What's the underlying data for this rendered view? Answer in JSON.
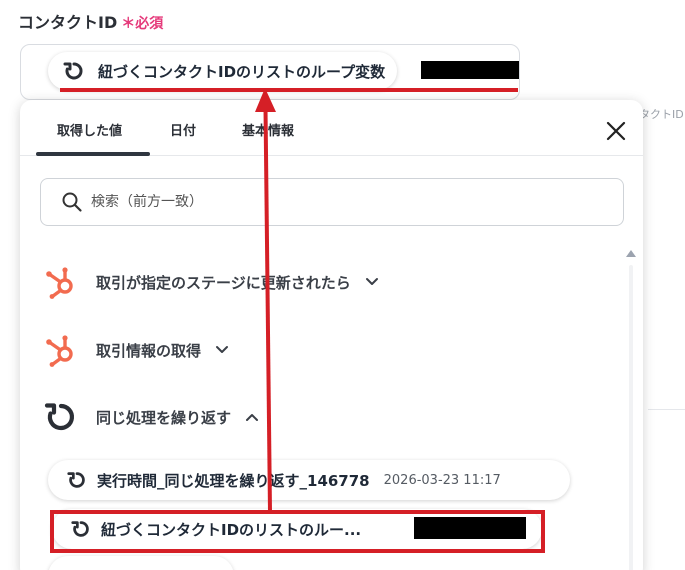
{
  "field": {
    "label": "コンタクトID",
    "required": "＊必須"
  },
  "selected_value": {
    "label": "紐づくコンタクトIDのリストのループ変数"
  },
  "background": {
    "partial_text": "タクトID"
  },
  "panel": {
    "tabs": [
      {
        "label": "取得した値",
        "active": true
      },
      {
        "label": "日付",
        "active": false
      },
      {
        "label": "基本情報",
        "active": false
      }
    ],
    "search_placeholder": "検索（前方一致）"
  },
  "tree": [
    {
      "label": "取引が指定のステージに更新されたら",
      "icon": "hubspot-icon",
      "expanded": false
    },
    {
      "label": "取引情報の取得",
      "icon": "hubspot-icon",
      "expanded": false
    },
    {
      "label": "同じ処理を繰り返す",
      "icon": "loop-icon",
      "expanded": true
    }
  ],
  "sub_items": [
    {
      "label": "実行時間_同じ処理を繰り返す_146778",
      "timestamp": "2026-03-23 11:17"
    },
    {
      "label": "紐づくコンタクトIDのリストのルー..."
    }
  ],
  "colors": {
    "highlight": "#d51f26",
    "hubspot": "#f26b4f",
    "required": "#e5397a"
  }
}
